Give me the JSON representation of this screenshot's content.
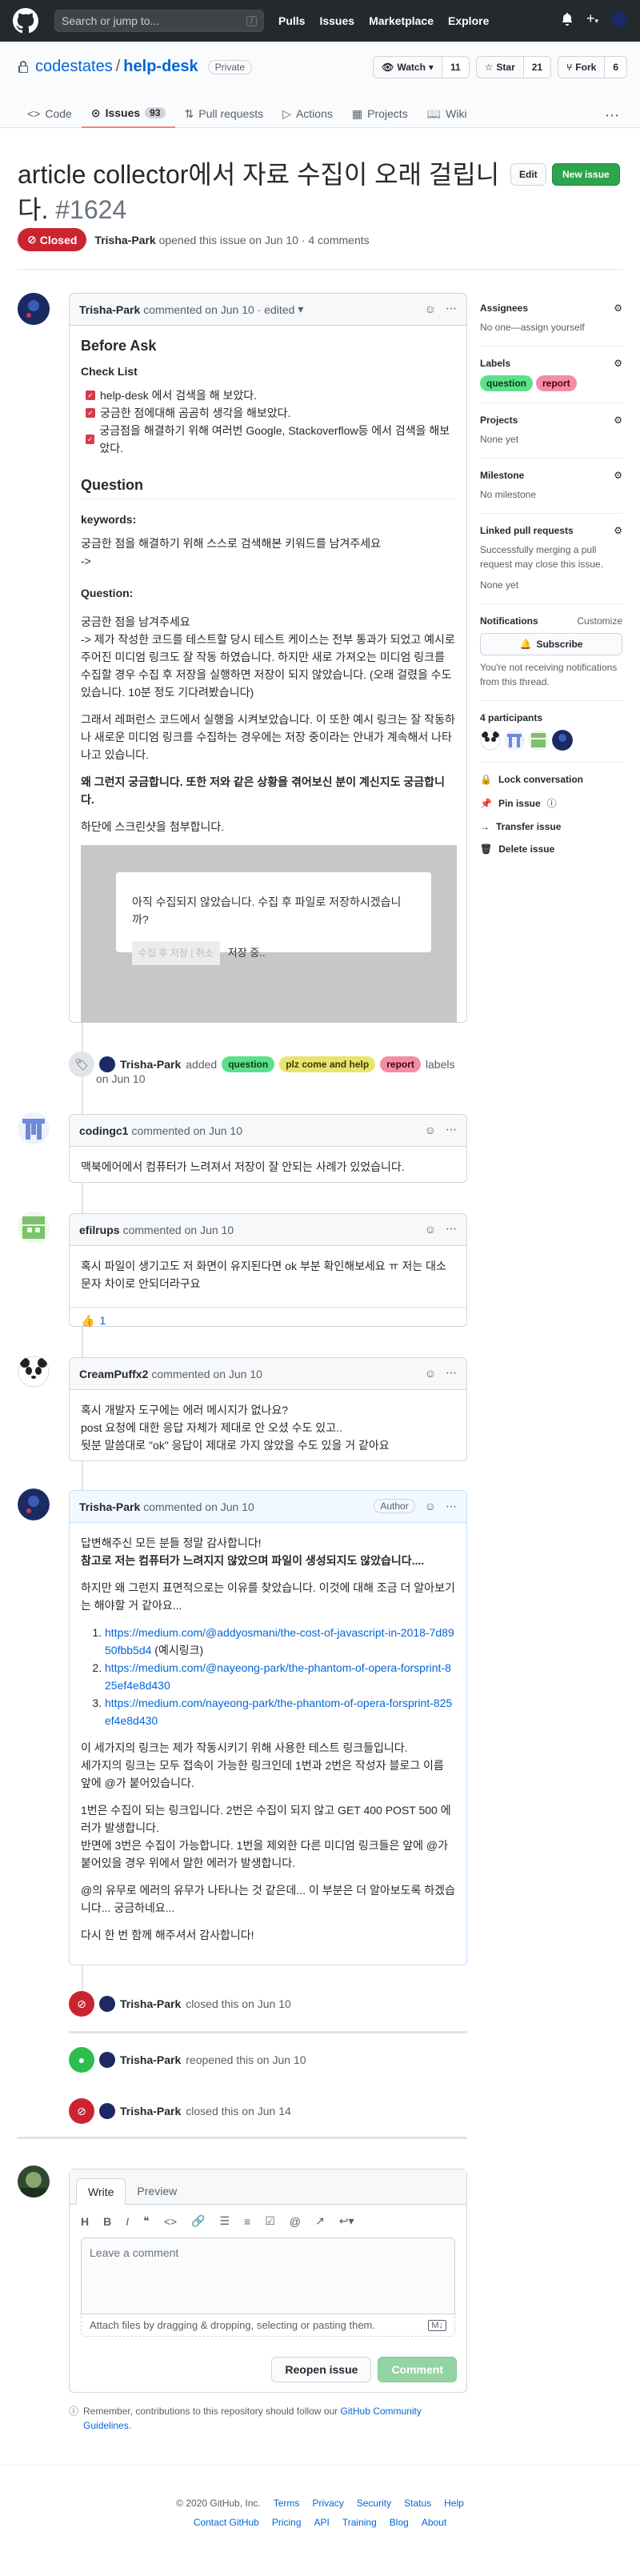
{
  "topbar": {
    "search_placeholder": "Search or jump to...",
    "slash": "/",
    "nav": [
      "Pulls",
      "Issues",
      "Marketplace",
      "Explore"
    ]
  },
  "repo": {
    "owner": "codestates",
    "sep": "/",
    "name": "help-desk",
    "visibility": "Private",
    "watch_label": "Watch",
    "watch_count": "11",
    "star_label": "Star",
    "star_count": "21",
    "fork_label": "Fork",
    "fork_count": "6",
    "tabs": [
      {
        "label": "Code"
      },
      {
        "label": "Issues",
        "count": "93"
      },
      {
        "label": "Pull requests"
      },
      {
        "label": "Actions"
      },
      {
        "label": "Projects"
      },
      {
        "label": "Wiki"
      }
    ]
  },
  "issue": {
    "title": "article collector에서 자료 수집이 오래 걸립니다.",
    "number": "#1624",
    "edit_label": "Edit",
    "new_label": "New issue",
    "state": "Closed",
    "opener": "Trisha-Park",
    "opened_text": "opened this issue on Jun 10 · 4 comments"
  },
  "first_comment": {
    "author": "Trisha-Park",
    "meta": "commented on Jun 10 · edited",
    "h_before": "Before Ask",
    "h_checklist": "Check List",
    "checks": [
      "help-desk 에서 검색을 해 보았다.",
      "궁금한 점에대해 곰곰히 생각을 해보았다.",
      "궁금점을 해결하기 위해 여러번 Google, Stackoverflow등 에서 검색을 해보았다."
    ],
    "h_question": "Question",
    "h_keywords": "keywords:",
    "keywords_text": "궁금한 점을 해결하기 위해 스스로 검색해본 키워드를 남겨주세요",
    "keywords_arrow": "->",
    "h_question2": "Question:",
    "q_p1": "궁금한 점을 남겨주세요",
    "q_p2": "-> 제가 작성한 코드를 테스트할 당시 테스트 케이스는 전부 통과가 되었고 예시로 주어진 미디엄 링크도 잘 작동 하였습니다. 하지만 새로 가져오는 미디엄 링크를 수집할 경우 수집 후 저장을 실행하면 저장이 되지 않았습니다. (오래 걸렸을 수도 있습니다. 10분 정도 기다려봤습니다)",
    "q_p3": "그래서 레퍼런스 코드에서 실행을 시켜보았습니다. 이 또한 예시 링크는 잘 작동하나 새로운 미디엄 링크를 수집하는 경우에는 저장 중이라는 안내가 계속해서 나타나고 있습니다.",
    "q_p4": "왜 그런지 궁금합니다. 또한 저와 같은 상황을 겪어보신 분이 계신지도 궁금합니다.",
    "q_p5": "하단에 스크린샷을 첨부합니다.",
    "embed_title": "아직 수집되지 않았습니다. 수집 후 파일로 저장하시겠습니까?",
    "embed_fake": "수집 후 저장 | 취소",
    "embed_saving": "저장 중.."
  },
  "label_event": {
    "actor": "Trisha-Park",
    "verb": "added",
    "labels": [
      {
        "name": "question",
        "bg": "#5ce08b",
        "fg": "#0b3d1b"
      },
      {
        "name": "plz come and help",
        "bg": "#e7e56d",
        "fg": "#3b3a00"
      },
      {
        "name": "report",
        "bg": "#f48ca6",
        "fg": "#4a0012"
      }
    ],
    "suffix": "labels",
    "date": "on Jun 10"
  },
  "comments": [
    {
      "author": "codingc1",
      "meta": "commented on Jun 10",
      "body": "맥북에어에서 컴퓨터가 느려져서 저장이 잘 안되는 사례가 있었습니다."
    },
    {
      "author": "efilrups",
      "meta": "commented on Jun 10",
      "body": "혹시 파일이 생기고도 저 화면이 유지된다면 ok 부분 확인해보세요 ㅠ 저는 대소문자 차이로 안되더라구요",
      "reaction_emoji": "👍",
      "reaction_count": "1"
    },
    {
      "author": "CreamPuffx2",
      "meta": "commented on Jun 10",
      "body_lines": [
        "혹시 개발자 도구에는 에러 메시지가 없나요?",
        "post 요청에 대한 응답 자체가 제대로 안 오셨 수도 있고..",
        "뒷분 말씀대로 \"ok\" 응답이 제대로 가지 않았을 수도 있을 거 같아요"
      ]
    }
  ],
  "author_comment": {
    "author": "Trisha-Park",
    "meta": "commented on Jun 10",
    "badge": "Author",
    "p1": "답변해주신 모든 분들 정말 감사합니다!",
    "p1b": "참고로 저는 컴퓨터가 느려지지 않았으며 파일이 생성되지도 않았습니다....",
    "p2": "하지만 왜 그런지 표면적으로는 이유를 찾았습니다. 이것에 대해 조금 더 알아보기는 해야할 거 같아요...",
    "links": [
      "https://medium.com/@addyosmani/the-cost-of-javascript-in-2018-7d8950fbb5d4",
      "https://medium.com/@nayeong-park/the-phantom-of-opera-forsprint-825ef4e8d430",
      "https://medium.com/nayeong-park/the-phantom-of-opera-forsprint-825ef4e8d430"
    ],
    "link1_suffix": "(예시링크)",
    "p3": "이 세가지의 링크는 제가 작동시키기 위해 사용한 테스트 링크들입니다.\n세가지의 링크는 모두 접속이 가능한 링크인데 1번과 2번은 작성자 블로그 이름 앞에 @가 붙어있습니다.",
    "p4": "1번은 수집이 되는 링크입니다. 2번은 수집이 되지 않고 GET 400 POST 500 에러가 발생합니다.\n반면에 3번은 수집이 가능합니다. 1번을 제외한 다른 미디엄 링크들은 앞에 @가 붙어있을 경우 위에서 말한 에러가 발생합니다.",
    "p5": "@의 유무로 에러의 유무가 나타나는 것 같은데... 이 부분은 더 알아보도록 하겠습니다... 궁금하네요...",
    "p6": "다시 한 번 함께 해주셔서 감사합니다!"
  },
  "events": [
    {
      "actor": "Trisha-Park",
      "text": "closed this on Jun 10",
      "kind": "closed"
    },
    {
      "actor": "Trisha-Park",
      "text": "reopened this on Jun 10",
      "kind": "reopened"
    },
    {
      "actor": "Trisha-Park",
      "text": "closed this on Jun 14",
      "kind": "closed"
    }
  ],
  "composer": {
    "tab_write": "Write",
    "tab_preview": "Preview",
    "placeholder": "Leave a comment",
    "attach_text": "Attach files by dragging & dropping, selecting or pasting them.",
    "reopen_label": "Reopen issue",
    "comment_label": "Comment"
  },
  "tip": {
    "text": "Remember, contributions to this repository should follow our",
    "link": "GitHub Community Guidelines",
    "end": "."
  },
  "sidebar": {
    "assignees_h": "Assignees",
    "assignees_v": "No one—assign yourself",
    "labels_h": "Labels",
    "labels": [
      {
        "name": "question",
        "bg": "#5ce08b",
        "fg": "#0b3d1b"
      },
      {
        "name": "report",
        "bg": "#f48ca6",
        "fg": "#4a0012"
      }
    ],
    "projects_h": "Projects",
    "projects_v": "None yet",
    "milestone_h": "Milestone",
    "milestone_v": "No milestone",
    "linked_h": "Linked pull requests",
    "linked_desc": "Successfully merging a pull request may close this issue.",
    "linked_v": "None yet",
    "notif_h": "Notifications",
    "notif_customize": "Customize",
    "subscribe_label": "Subscribe",
    "notif_desc": "You're not receiving notifications from this thread.",
    "participants_h": "4 participants",
    "actions": [
      "Lock conversation",
      "Pin issue",
      "Transfer issue",
      "Delete issue"
    ]
  },
  "footer": {
    "copyright": "© 2020 GitHub, Inc.",
    "row1": [
      "Terms",
      "Privacy",
      "Security",
      "Status",
      "Help"
    ],
    "row2": [
      "Contact GitHub",
      "Pricing",
      "API",
      "Training",
      "Blog",
      "About"
    ]
  }
}
